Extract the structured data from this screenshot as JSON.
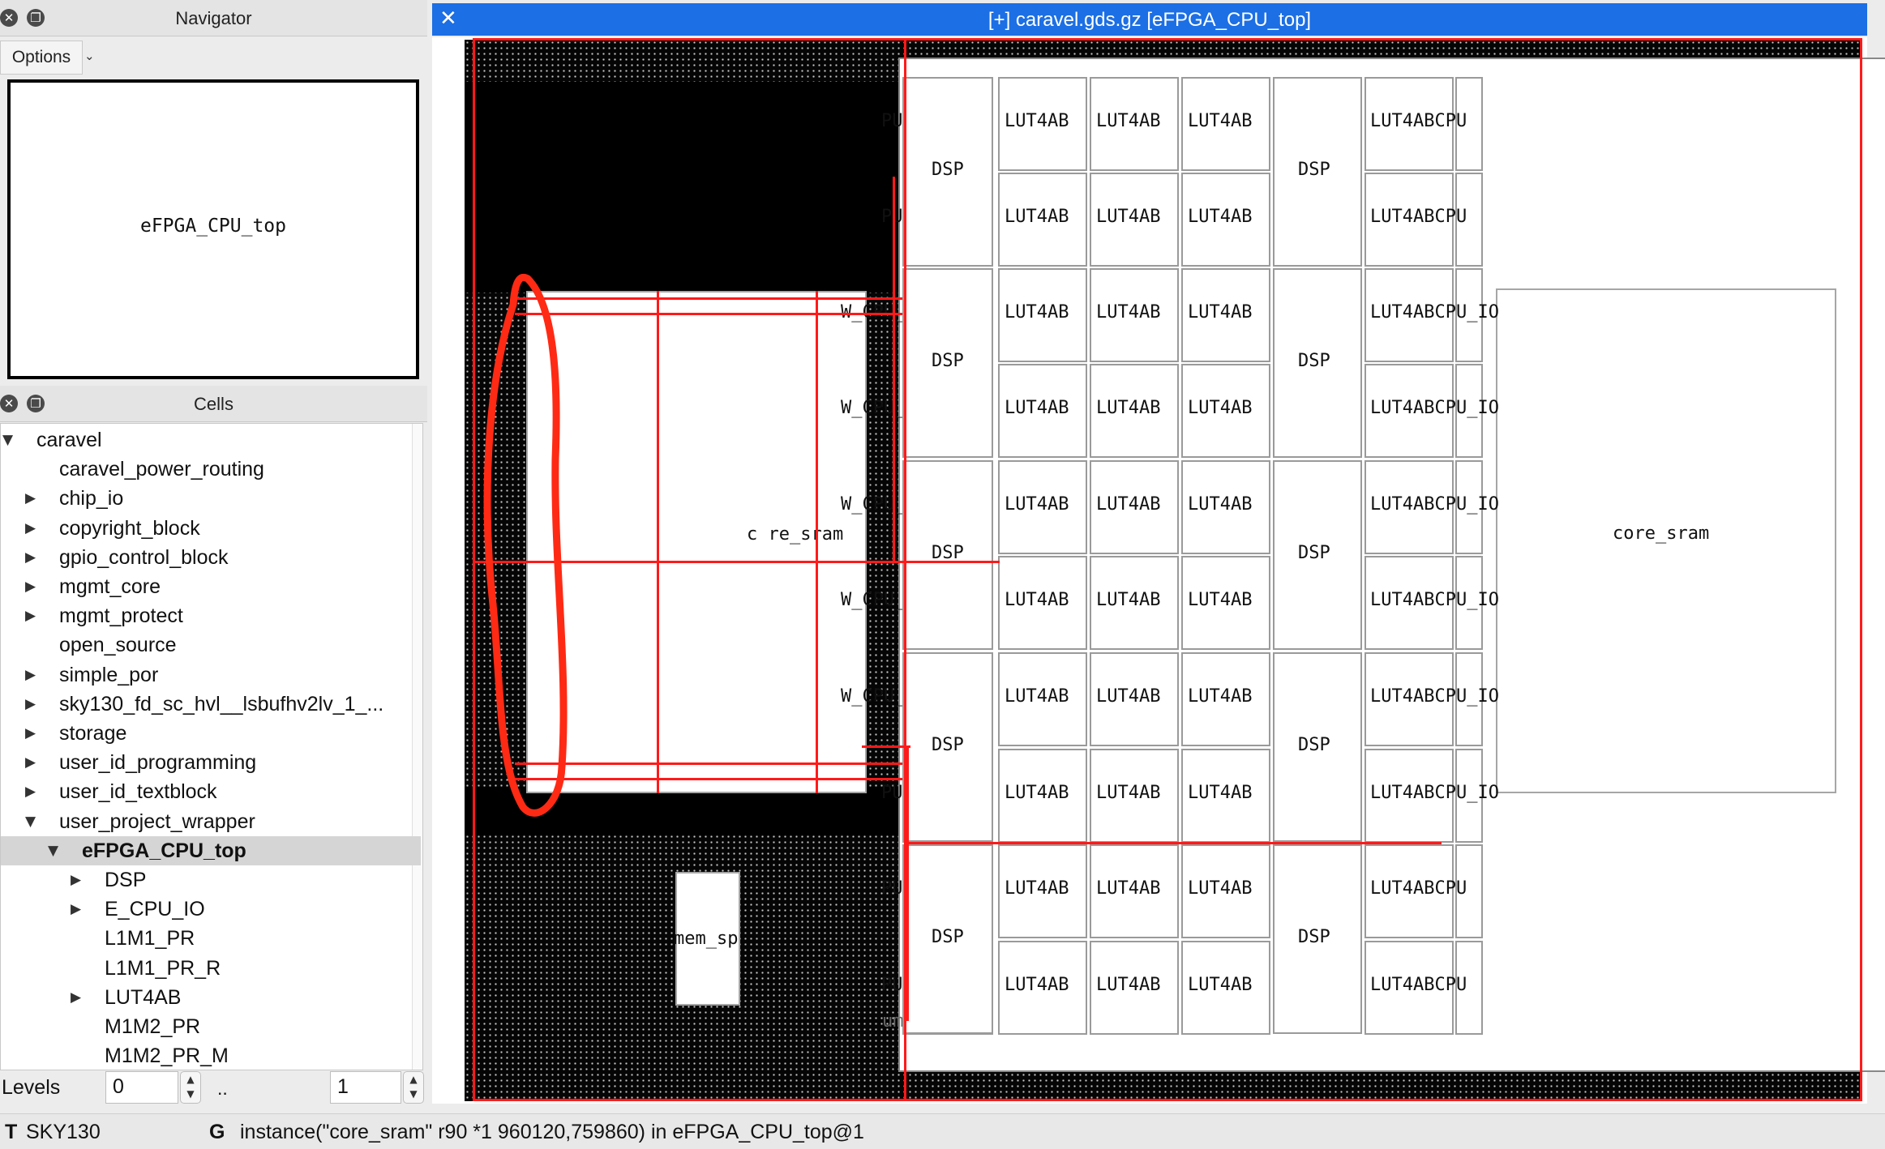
{
  "navigator": {
    "title": "Navigator",
    "options_label": "Options",
    "cell_name": "eFPGA_CPU_top"
  },
  "cells_panel": {
    "title": "Cells",
    "tree": [
      {
        "label": "caravel",
        "expanded": true,
        "depth": 0,
        "has_children": true
      },
      {
        "label": "caravel_power_routing",
        "depth": 1,
        "has_children": false
      },
      {
        "label": "chip_io",
        "depth": 1,
        "has_children": true
      },
      {
        "label": "copyright_block",
        "depth": 1,
        "has_children": true
      },
      {
        "label": "gpio_control_block",
        "depth": 1,
        "has_children": true
      },
      {
        "label": "mgmt_core",
        "depth": 1,
        "has_children": true
      },
      {
        "label": "mgmt_protect",
        "depth": 1,
        "has_children": true
      },
      {
        "label": "open_source",
        "depth": 1,
        "has_children": false
      },
      {
        "label": "simple_por",
        "depth": 1,
        "has_children": true
      },
      {
        "label": "sky130_fd_sc_hvl__lsbufhv2lv_1_...",
        "depth": 1,
        "has_children": true
      },
      {
        "label": "storage",
        "depth": 1,
        "has_children": true
      },
      {
        "label": "user_id_programming",
        "depth": 1,
        "has_children": true
      },
      {
        "label": "user_id_textblock",
        "depth": 1,
        "has_children": true
      },
      {
        "label": "user_project_wrapper",
        "depth": 1,
        "has_children": true,
        "expanded": true
      },
      {
        "label": "eFPGA_CPU_top",
        "depth": 2,
        "has_children": true,
        "expanded": true,
        "selected": true
      },
      {
        "label": "DSP",
        "depth": 3,
        "has_children": true
      },
      {
        "label": "E_CPU_IO",
        "depth": 3,
        "has_children": true
      },
      {
        "label": "L1M1_PR",
        "depth": 3,
        "has_children": false
      },
      {
        "label": "L1M1_PR_R",
        "depth": 3,
        "has_children": false
      },
      {
        "label": "LUT4AB",
        "depth": 3,
        "has_children": true
      },
      {
        "label": "M1M2_PR",
        "depth": 3,
        "has_children": false
      },
      {
        "label": "M1M2_PR_M",
        "depth": 3,
        "has_children": false
      }
    ],
    "levels_label": "Levels",
    "levels_from": "0",
    "levels_sep": "..",
    "levels_to": "1"
  },
  "layout_view": {
    "title": "[+] caravel.gds.gz [eFPGA_CPU_top]",
    "labels": {
      "core_sram": "core_sram",
      "core_sram_left": "c  re_sram",
      "dsp": "DSP",
      "lut": "LUT4AB",
      "pu_io": "PU_IO",
      "w_cpu_io": "W_CPU_IO",
      "lut4ab_cpu": "LUT4ABCPU",
      "lut4ab_cpu_io": "LUT4ABCPU_IO",
      "mem_sp": "mem_sp",
      "um": "um"
    }
  },
  "status_bar": {
    "tech_key": "T",
    "tech_value": "SKY130",
    "grid_key": "G",
    "message": "instance(\"core_sram\" r90 *1 960120,759860) in eFPGA_CPU_top@1"
  },
  "colors": {
    "title_bar": "#1c6fe4",
    "highlight": "#ff1a1a",
    "selection": "#d5d5d5"
  }
}
